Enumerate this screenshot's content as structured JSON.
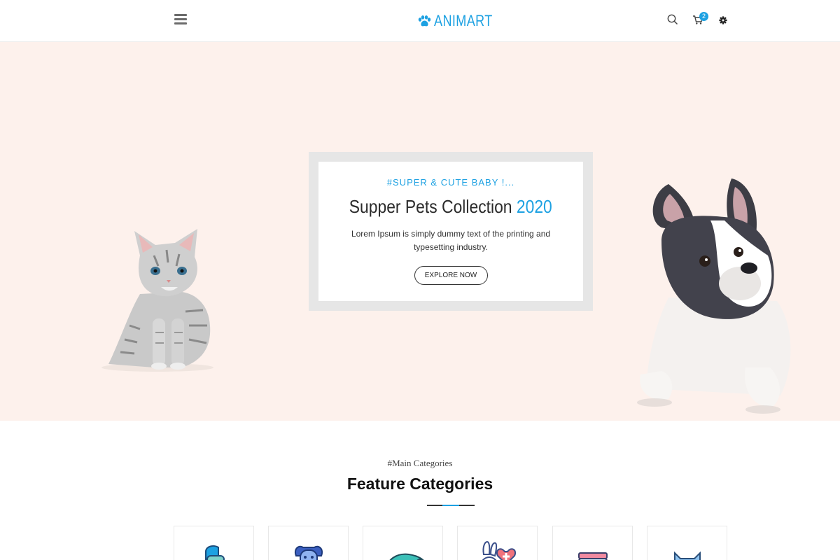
{
  "header": {
    "logo_text": "ANIMART",
    "cart_count": "2",
    "icons": [
      "menu-icon",
      "paw-icon",
      "search-icon",
      "cart-icon",
      "gear-icon"
    ]
  },
  "hero": {
    "tag": "#SUPER & CUTE BABY !...",
    "title_main": "Supper Pets Collection ",
    "title_year": "2020",
    "description": "Lorem Ipsum is simply dummy text of the printing and typesetting industry.",
    "button_label": "EXPLORE NOW"
  },
  "categories": {
    "subtitle": "#Main Categories",
    "title": "Feature Categories",
    "items": [
      {
        "icon": "bird-feeder-icon"
      },
      {
        "icon": "dog-icon"
      },
      {
        "icon": "chameleon-icon"
      },
      {
        "icon": "rabbit-health-icon"
      },
      {
        "icon": "fish-bowl-icon"
      },
      {
        "icon": "cat-icon"
      }
    ]
  },
  "colors": {
    "accent": "#1da1e2",
    "hero_bg": "#fdf1ec",
    "frame": "#e6e6e6"
  }
}
